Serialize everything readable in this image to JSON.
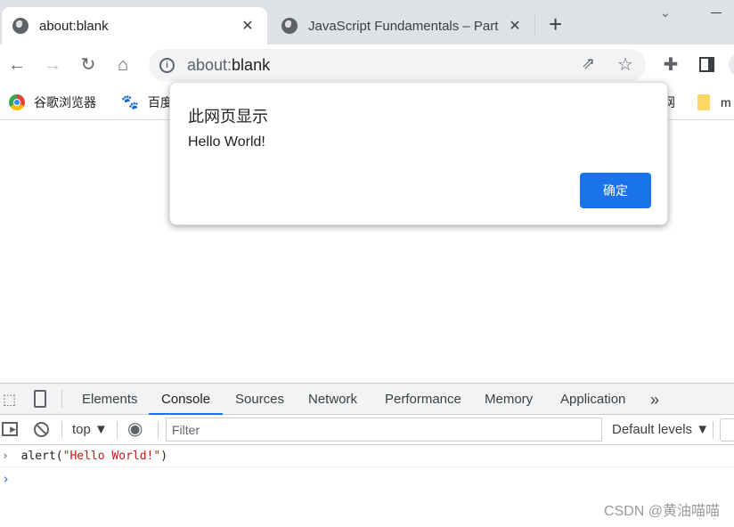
{
  "tabs": [
    {
      "title": "about:blank",
      "icon": "globe-icon"
    },
    {
      "title": "JavaScript Fundamentals – Part",
      "icon": "globe-icon"
    }
  ],
  "toolbar": {
    "url_prefix": "about:",
    "url_host": "blank"
  },
  "bookmarks": [
    {
      "label": "谷歌浏览器",
      "icon": "chrome-icon"
    },
    {
      "label": "百度",
      "icon": "baidu-paw-icon"
    },
    {
      "label": "网",
      "icon": ""
    },
    {
      "label": "m",
      "icon": "folder-icon"
    }
  ],
  "dialog": {
    "title": "此网页显示",
    "message": "Hello World!",
    "ok_label": "确定",
    "accent": "#1a73e8"
  },
  "devtools": {
    "tabs": [
      "Elements",
      "Console",
      "Sources",
      "Network",
      "Performance",
      "Memory",
      "Application"
    ],
    "active_tab": "Console",
    "more": "»",
    "context": "top ▼",
    "filter_placeholder": "Filter",
    "levels": "Default levels ▼",
    "console": {
      "input_fn": "alert(",
      "input_str": "\"Hello World!\"",
      "input_close": ")",
      "prompt": "›"
    }
  },
  "watermark": "CSDN @黄油喵喵"
}
